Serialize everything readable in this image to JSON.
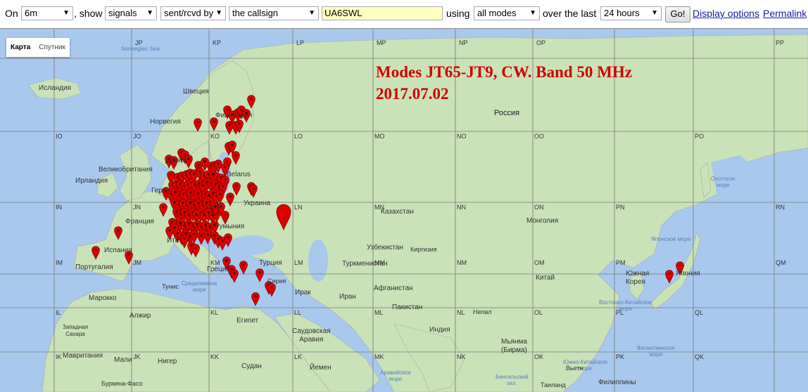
{
  "toolbar": {
    "on_label": "On",
    "band": "6m",
    "show_label": ", show",
    "show_value": "signals",
    "direction": "sent/rcvd by",
    "target": "the callsign",
    "callsign": "UA6SWL",
    "using_label": "using",
    "modes": "all modes",
    "over_label": "over the last",
    "period": "24 hours",
    "go_label": "Go!",
    "display_options": "Display options",
    "permalink": "Permalink"
  },
  "map_type": {
    "map": "Карта",
    "satellite": "Спутник"
  },
  "overlay": {
    "line1": "Modes JT65-JT9, CW. Band 50 MHz",
    "line2": "2017.07.02"
  },
  "colors": {
    "marker": "#dd0000",
    "overlay_text": "#d00000",
    "water": "#a9c8ee",
    "land": "#c9e2b8"
  },
  "grid_labels": [
    [
      "JP",
      "KP",
      "LP",
      "MP",
      "NP",
      "OP",
      "PP"
    ],
    [
      "IO",
      "JO",
      "KO",
      "LO",
      "MO",
      "NO",
      "OO",
      "PO"
    ],
    [
      "IN",
      "JN",
      "KN",
      "LN",
      "MN",
      "NN",
      "ON",
      "PN",
      "RN"
    ],
    [
      "IM",
      "JM",
      "KM",
      "LM",
      "MM",
      "NM",
      "OM",
      "PM",
      "QM"
    ],
    [
      "IL",
      "KL",
      "LL",
      "ML",
      "NL",
      "OL",
      "PL",
      "QL"
    ],
    [
      "IK",
      "JK",
      "KK",
      "LK",
      "MK",
      "NK",
      "OK",
      "PK",
      "QK"
    ]
  ],
  "places": {
    "norwegian_sea": "Norwegian Sea",
    "iceland": "Исландия",
    "sweden": "Швеция",
    "finland": "Финляндия",
    "norway": "Норвегия",
    "russia": "Россия",
    "uk": "Великобритания",
    "ireland": "Ирландия",
    "denmark": "Дания",
    "belarus": "Belarus",
    "germany": "Герм",
    "ukraine": "Украина",
    "france": "Франция",
    "kazakhstan": "Казахстан",
    "mongolia": "Монголия",
    "romania": "Румыния",
    "italy": "Ита",
    "spain": "Испания",
    "portugal": "Португалия",
    "uzbekistan": "Узбекистан",
    "kyrgyzstan": "Киргизия",
    "turkmenistan": "Туркменистан",
    "turkey": "Турция",
    "china": "Китай",
    "south_korea": "Южная\nКорея",
    "japan": "Япония",
    "greece": "Греция",
    "tunisia": "Тунис",
    "syria": "Сирия",
    "mediterranean": "Средиземное\nморе",
    "morocco": "Марокко",
    "iraq": "Ирак",
    "iran": "Иран",
    "afghanistan": "Афганистан",
    "pakistan": "Пакистан",
    "algeria": "Алжир",
    "egypt": "Египет",
    "saudi": "Саудовская\nАравия",
    "india": "Индия",
    "nepal": "Непал",
    "myanmar": "Мьянма\n(Бирма)",
    "w_sahara": "Западная\nСахара",
    "mauritania": "Мавритания",
    "mali": "Мали",
    "niger": "Нигер",
    "sudan": "Судан",
    "yemen": "Йемен",
    "arabian_sea": "Аравийское\nморе",
    "bengal": "Бенгальский\nзал.",
    "thailand": "Таиланд",
    "vietnam": "Вьетн",
    "philippines": "Филиппины",
    "okhotsk": "Охотское\nморе",
    "japan_sea": "Японское море",
    "east_china_sea": "Восточно-Китайское\nморе",
    "philippine_sea": "Филиппинское\nморе",
    "south_china_sea": "Южно-Китайское\nморе",
    "burkina": "Буркина-Фасо"
  }
}
